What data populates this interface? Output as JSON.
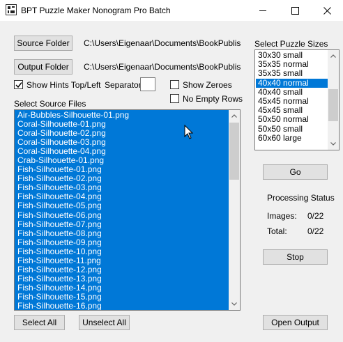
{
  "window": {
    "title": "BPT Puzzle Maker Nonogram Pro Batch",
    "minimize_glyph": "—",
    "maximize_glyph": "☐",
    "close_glyph": "✕"
  },
  "source": {
    "button_label": "Source Folder",
    "path": "C:\\Users\\Eigenaar\\Documents\\BookPublisher"
  },
  "output": {
    "button_label": "Output Folder",
    "path": "C:\\Users\\Eigenaar\\Documents\\BookPublisher"
  },
  "options": {
    "show_hints_label": "Show Hints Top/Left",
    "show_hints_checked": true,
    "separator_label": "Separator",
    "separator_value": "",
    "show_zeroes_label": "Show Zeroes",
    "show_zeroes_checked": false,
    "no_empty_rows_label": "No Empty Rows",
    "no_empty_rows_checked": false
  },
  "sizes": {
    "label": "Select Puzzle Sizes",
    "items": [
      {
        "text": "30x30 small",
        "selected": false
      },
      {
        "text": "35x35 normal",
        "selected": false
      },
      {
        "text": "35x35 small",
        "selected": false
      },
      {
        "text": "40x40 normal",
        "selected": true
      },
      {
        "text": "40x40 small",
        "selected": false
      },
      {
        "text": "45x45 normal",
        "selected": false
      },
      {
        "text": "45x45 small",
        "selected": false
      },
      {
        "text": "50x50 normal",
        "selected": false
      },
      {
        "text": "50x50 small",
        "selected": false
      },
      {
        "text": "60x60 large",
        "selected": false
      }
    ]
  },
  "files": {
    "label": "Select Source Files",
    "items": [
      "Air-Bubbles-Silhouette-01.png",
      "Coral-Silhouette-01.png",
      "Coral-Silhouette-02.png",
      "Coral-Silhouette-03.png",
      "Coral-Silhouette-04.png",
      "Crab-Silhouette-01.png",
      "Fish-Silhouette-01.png",
      "Fish-Silhouette-02.png",
      "Fish-Silhouette-03.png",
      "Fish-Silhouette-04.png",
      "Fish-Silhouette-05.png",
      "Fish-Silhouette-06.png",
      "Fish-Silhouette-07.png",
      "Fish-Silhouette-08.png",
      "Fish-Silhouette-09.png",
      "Fish-Silhouette-10.png",
      "Fish-Silhouette-11.png",
      "Fish-Silhouette-12.png",
      "Fish-Silhouette-13.png",
      "Fish-Silhouette-14.png",
      "Fish-Silhouette-15.png",
      "Fish-Silhouette-16.png"
    ]
  },
  "actions": {
    "go": "Go",
    "stop": "Stop",
    "select_all": "Select All",
    "unselect_all": "Unselect All",
    "open_output": "Open Output"
  },
  "status": {
    "heading": "Processing Status",
    "images_label": "Images:",
    "images_value": "0/22",
    "total_label": "Total:",
    "total_value": "0/22"
  },
  "colors": {
    "selection": "#0078d7",
    "button_face": "#e1e1e1",
    "window_bg": "#f0f0f0"
  }
}
